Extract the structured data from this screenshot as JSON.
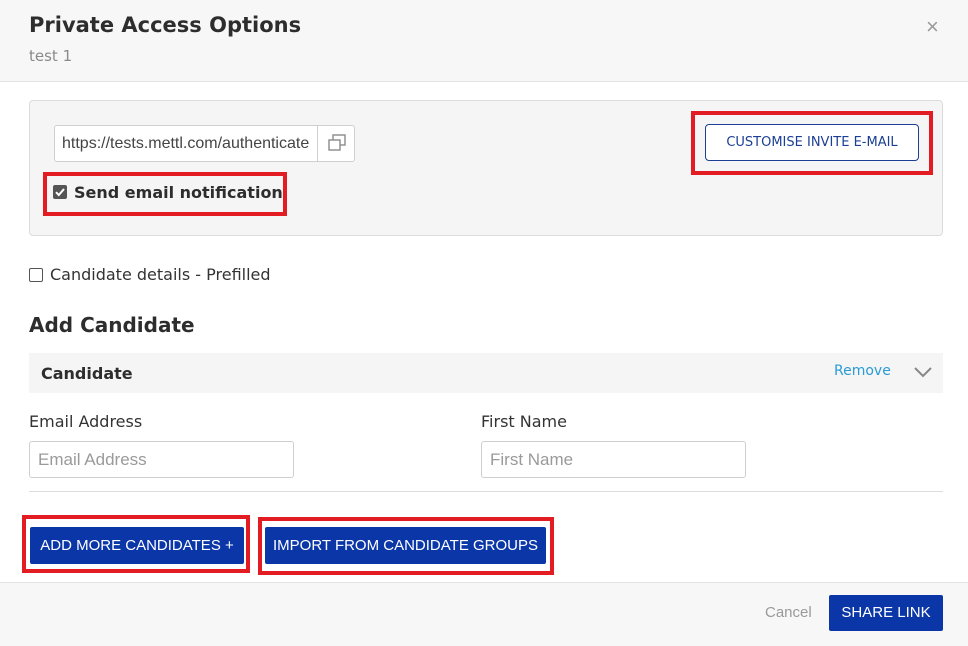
{
  "dialog": {
    "title": "Private Access Options",
    "subtitle": "test 1",
    "close_glyph": "×"
  },
  "link_panel": {
    "url": "https://tests.mettl.com/authenticate",
    "copy_icon": "copy-icon",
    "send_email_label": "Send email notification",
    "send_email_checked": true,
    "customise_invite_label": "CUSTOMISE INVITE E-MAIL"
  },
  "prefill": {
    "label": "Candidate details - Prefilled",
    "checked": false
  },
  "add_candidate": {
    "heading": "Add Candidate",
    "card_title": "Candidate",
    "remove_label": "Remove",
    "email_label": "Email Address",
    "email_placeholder": "Email Address",
    "first_name_label": "First Name",
    "first_name_placeholder": "First Name"
  },
  "actions": {
    "add_more_label": "ADD MORE CANDIDATES +",
    "import_groups_label": "IMPORT FROM CANDIDATE GROUPS"
  },
  "footer": {
    "cancel_label": "Cancel",
    "share_label": "SHARE LINK"
  },
  "colors": {
    "primary": "#0a36a8",
    "highlight": "#e31b23",
    "link": "#2a9bd6"
  }
}
